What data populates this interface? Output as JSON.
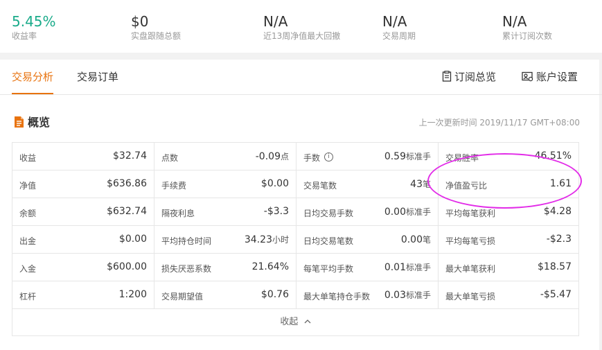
{
  "stats": [
    {
      "value": "5.45%",
      "label": "收益率",
      "color": "#1aab8a"
    },
    {
      "value": "$0",
      "label": "实盘跟随总额"
    },
    {
      "value": "N/A",
      "label": "近13周净值最大回撤"
    },
    {
      "value": "N/A",
      "label": "交易周期"
    },
    {
      "value": "N/A",
      "label": "累计订阅次数"
    }
  ],
  "tabs": {
    "analysis": "交易分析",
    "orders": "交易订单",
    "subscription_overview": "订阅总览",
    "account_settings": "账户设置"
  },
  "overview": {
    "title": "概览",
    "updated": "上一次更新时间 2019/11/17 GMT+08:00",
    "collapse": "收起"
  },
  "table": {
    "rows": [
      [
        {
          "k": "收益",
          "v": "$32.74"
        },
        {
          "k": "点数",
          "v": "-0.09",
          "u": "点"
        },
        {
          "k": "手数",
          "v": "0.59",
          "u": "标准手",
          "info": true
        },
        {
          "k": "交易胜率",
          "v": "46.51%"
        }
      ],
      [
        {
          "k": "净值",
          "v": "$636.86"
        },
        {
          "k": "手续费",
          "v": "$0.00"
        },
        {
          "k": "交易笔数",
          "v": "43",
          "u": "笔"
        },
        {
          "k": "净值盈亏比",
          "v": "1.61"
        }
      ],
      [
        {
          "k": "余额",
          "v": "$632.74"
        },
        {
          "k": "隔夜利息",
          "v": "-$3.3"
        },
        {
          "k": "日均交易手数",
          "v": "0.00",
          "u": "标准手"
        },
        {
          "k": "平均每笔获利",
          "v": "$4.28"
        }
      ],
      [
        {
          "k": "出金",
          "v": "$0.00"
        },
        {
          "k": "平均持仓时间",
          "v": "34.23",
          "u": "小时"
        },
        {
          "k": "日均交易笔数",
          "v": "0.00",
          "u": "笔"
        },
        {
          "k": "平均每笔亏损",
          "v": "-$2.3"
        }
      ],
      [
        {
          "k": "入金",
          "v": "$600.00"
        },
        {
          "k": "损失厌恶系数",
          "v": "21.64%"
        },
        {
          "k": "每笔平均手数",
          "v": "0.01",
          "u": "标准手"
        },
        {
          "k": "最大单笔获利",
          "v": "$18.57"
        }
      ],
      [
        {
          "k": "杠杆",
          "v": "1:200"
        },
        {
          "k": "交易期望值",
          "v": "$0.76"
        },
        {
          "k": "最大单笔持仓手数",
          "v": "0.03",
          "u": "标准手"
        },
        {
          "k": "最大单笔亏损",
          "v": "-$5.47"
        }
      ]
    ]
  },
  "colors": {
    "accent": "#e8730f",
    "green": "#1aab8a",
    "highlight": "#e22ce8"
  }
}
